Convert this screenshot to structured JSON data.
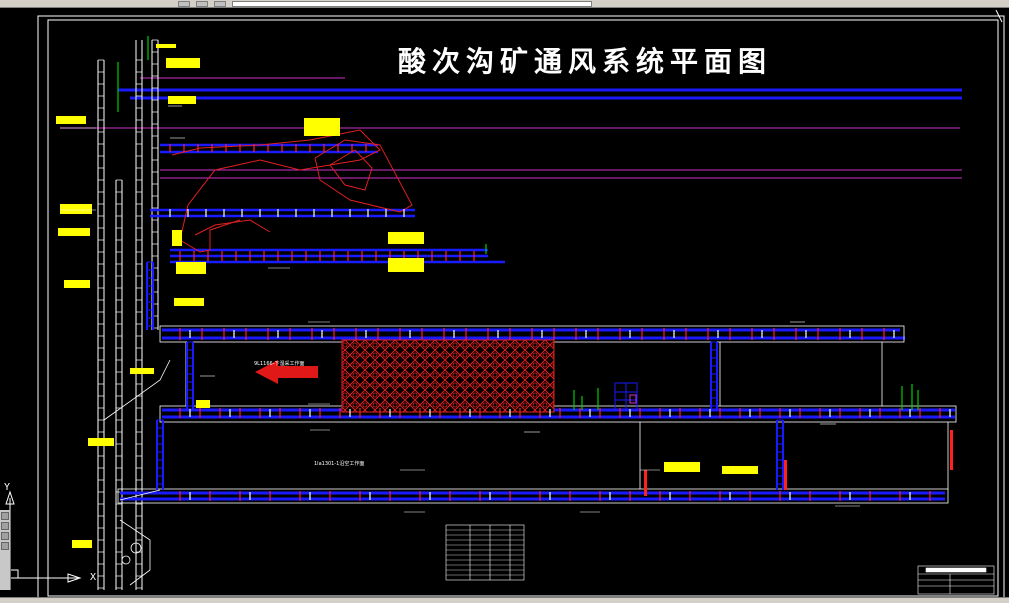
{
  "drawing": {
    "title": "酸次沟矿通风系统平面图",
    "workface_label": "9L1166-下湿采工作面",
    "lower_label": "1la1301-1沿空工作面"
  },
  "colors": {
    "background": "#000000",
    "airway": "#1a1aff",
    "frame": "#ffffff",
    "fresh_air": "#00cc00",
    "return_air": "#ff2020",
    "goaf": "#e02020",
    "annotation": "#ffff00",
    "boundary": "#cc33cc"
  },
  "ucs": {
    "x_label": "X",
    "y_label": "Y"
  },
  "icons": [
    "ucs-icon",
    "airflow-arrow-icon"
  ]
}
